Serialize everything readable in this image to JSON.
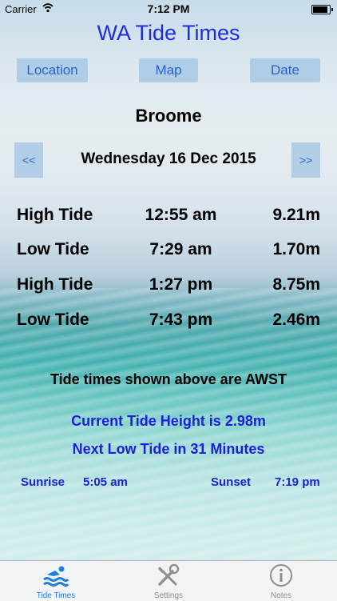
{
  "status_bar": {
    "carrier": "Carrier",
    "time": "7:12 PM"
  },
  "app_title": "WA Tide Times",
  "buttons": {
    "location": "Location",
    "map": "Map",
    "date": "Date",
    "prev": "<<",
    "next": ">>"
  },
  "location_name": "Broome",
  "date_text": "Wednesday 16 Dec 2015",
  "tides": [
    {
      "label": "High Tide",
      "time": "12:55 am",
      "height": "9.21m"
    },
    {
      "label": "Low Tide",
      "time": "7:29 am",
      "height": "1.70m"
    },
    {
      "label": "High Tide",
      "time": "1:27 pm",
      "height": "8.75m"
    },
    {
      "label": "Low Tide",
      "time": "7:43 pm",
      "height": "2.46m"
    }
  ],
  "timezone_note": "Tide times shown above are AWST",
  "current_height": "Current Tide Height is 2.98m",
  "next_tide": "Next Low Tide in 31 Minutes",
  "sun": {
    "sunrise_label": "Sunrise",
    "sunrise_time": "5:05 am",
    "sunset_label": "Sunset",
    "sunset_time": "7:19 pm"
  },
  "tabs": [
    {
      "label": "Tide Times",
      "icon": "swimmer-icon",
      "active": true
    },
    {
      "label": "Settings",
      "icon": "tools-icon",
      "active": false
    },
    {
      "label": "Notes",
      "icon": "info-icon",
      "active": false
    }
  ],
  "colors": {
    "title": "#1d2ce0",
    "button_text": "#2b63c8",
    "info_text": "#1b1fd6",
    "active_tab": "#1e7ed8",
    "inactive_tab": "#8e8e93"
  }
}
